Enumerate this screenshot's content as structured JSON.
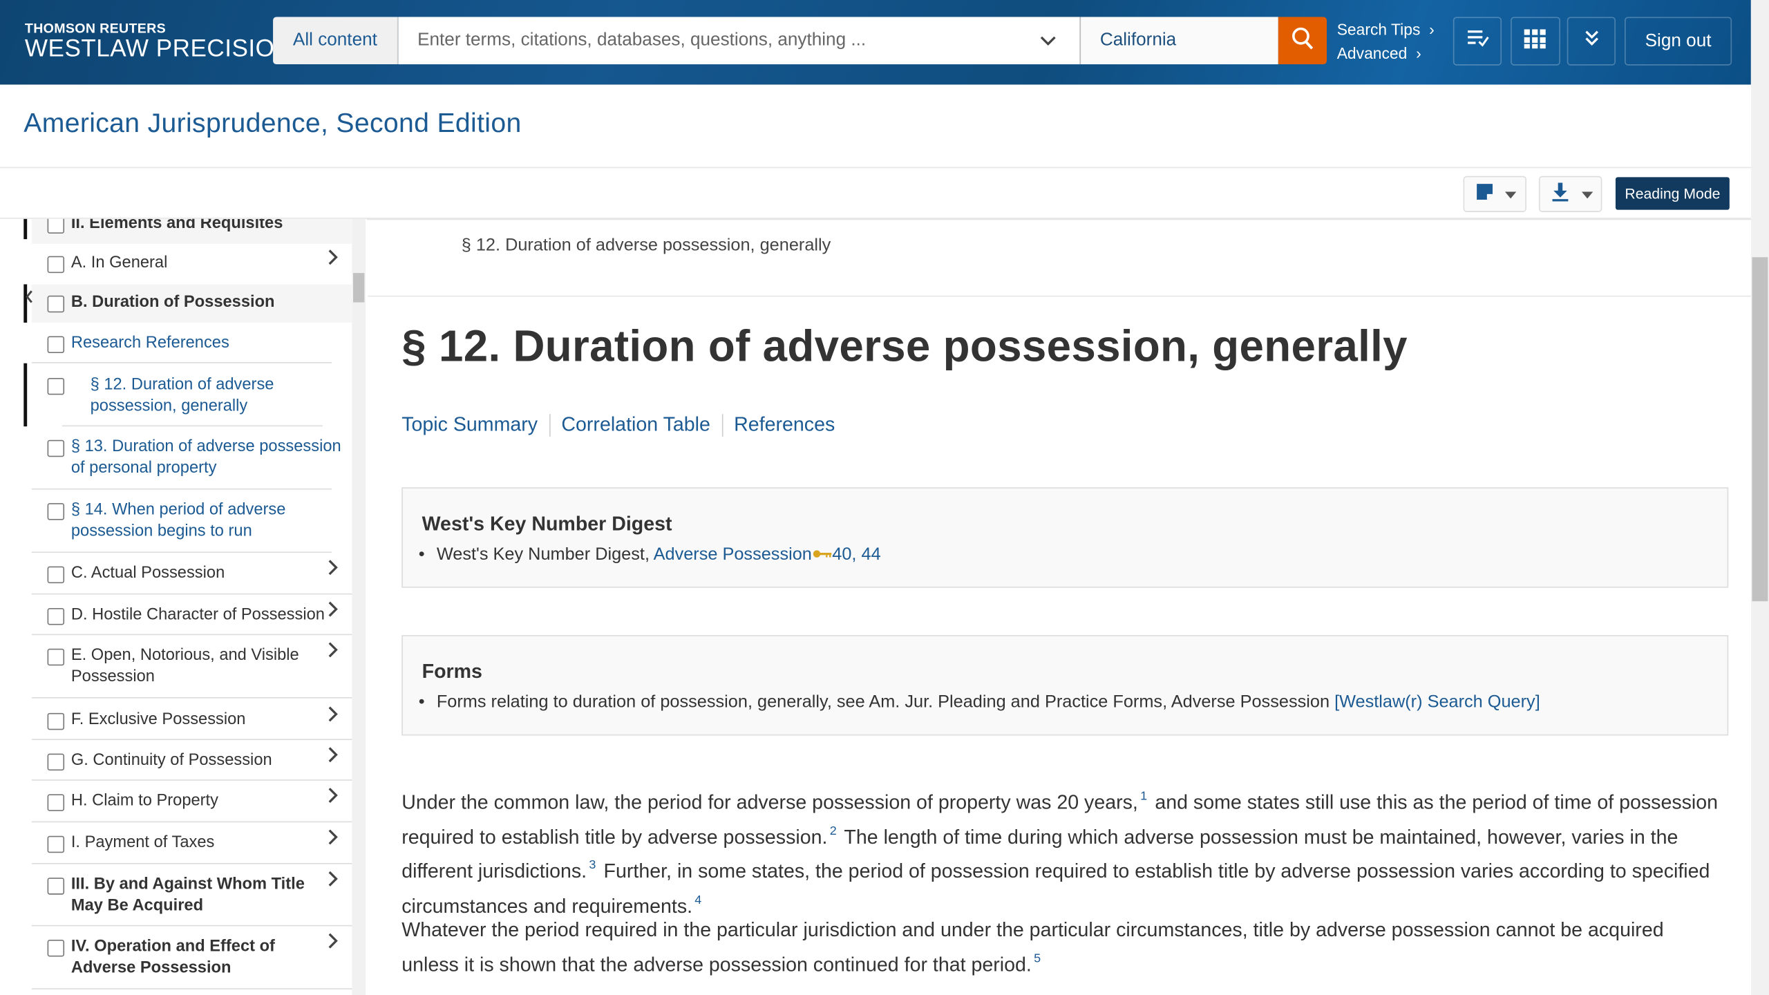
{
  "header": {
    "brand_top": "THOMSON REUTERS",
    "brand_main": "WESTLAW PRECISION",
    "scope_label": "All content",
    "search_placeholder": "Enter terms, citations, databases, questions, anything ...",
    "search_value": "",
    "jurisdiction": "California",
    "search_tips": "Search Tips",
    "advanced": "Advanced",
    "sign_out": "Sign out",
    "icons": [
      "search-icon",
      "history-icon",
      "apps-grid-icon",
      "more-chevrons-icon"
    ]
  },
  "document": {
    "title": "American Jurisprudence, Second Edition",
    "toolbar": {
      "annotate_icon": "note-icon",
      "download_icon": "download-icon",
      "reading_mode": "Reading Mode"
    },
    "breadcrumb": "§ 12. Duration of adverse possession, generally",
    "heading": "§ 12. Duration of adverse possession, generally",
    "tabs": [
      "Topic Summary",
      "Correlation Table",
      "References"
    ],
    "key_number": {
      "heading": "West's Key Number Digest",
      "item_prefix": "West's Key Number Digest, ",
      "link": "Adverse Possession",
      "numbers": "40, 44"
    },
    "forms": {
      "heading": "Forms",
      "item_text": "Forms relating to duration of possession, generally, see Am. Jur. Pleading and Practice Forms, Adverse Possession ",
      "link": "[Westlaw(r) Search Query]"
    },
    "paragraphs": [
      {
        "segments": [
          "Under the common law, the period for adverse possession of property was 20 years,",
          "1",
          " and some states still use this as the period of time of possession required to establish title by adverse possession.",
          "2",
          " The length of time during which adverse possession must be maintained, however, varies in the different jurisdictions.",
          "3",
          " Further, in some states, the period of possession required to establish title by adverse possession varies according to specified circumstances and requirements.",
          "4"
        ]
      },
      {
        "segments": [
          "Whatever the period required in the particular jurisdiction and under the particular circumstances, title by adverse possession cannot be acquired unless it is shown that the adverse possession continued for that period.",
          "5"
        ]
      }
    ]
  },
  "toc": [
    {
      "label": "II. Elements and Requisites",
      "bold": true,
      "link": false,
      "expand": false,
      "checked": false
    },
    {
      "label": "A. In General",
      "bold": false,
      "link": false,
      "expand": true,
      "checked": false
    },
    {
      "label": "B. Duration of Possession",
      "bold": true,
      "link": false,
      "expand": false,
      "checked": false
    },
    {
      "label": "Research References",
      "bold": false,
      "link": true,
      "expand": false,
      "checked": false
    },
    {
      "label": "§ 12. Duration of adverse possession, generally",
      "bold": false,
      "link": true,
      "expand": false,
      "checked": false,
      "current": true
    },
    {
      "label": "§ 13. Duration of adverse possession of personal property",
      "bold": false,
      "link": true,
      "expand": false,
      "checked": false
    },
    {
      "label": "§ 14. When period of adverse possession begins to run",
      "bold": false,
      "link": true,
      "expand": false,
      "checked": false
    },
    {
      "label": "C. Actual Possession",
      "bold": false,
      "link": false,
      "expand": true,
      "checked": false
    },
    {
      "label": "D. Hostile Character of Possession",
      "bold": false,
      "link": false,
      "expand": true,
      "checked": false
    },
    {
      "label": "E. Open, Notorious, and Visible Possession",
      "bold": false,
      "link": false,
      "expand": true,
      "checked": false
    },
    {
      "label": "F. Exclusive Possession",
      "bold": false,
      "link": false,
      "expand": true,
      "checked": false
    },
    {
      "label": "G. Continuity of Possession",
      "bold": false,
      "link": false,
      "expand": true,
      "checked": false
    },
    {
      "label": "H. Claim to Property",
      "bold": false,
      "link": false,
      "expand": true,
      "checked": false
    },
    {
      "label": "I. Payment of Taxes",
      "bold": false,
      "link": false,
      "expand": true,
      "checked": false
    },
    {
      "label": "III. By and Against Whom Title May Be Acquired",
      "bold": true,
      "link": false,
      "expand": true,
      "checked": false
    },
    {
      "label": "IV. Operation and Effect of Adverse Possession",
      "bold": true,
      "link": false,
      "expand": true,
      "checked": false
    }
  ],
  "colors": {
    "brand_blue": "#1c5a93",
    "header_bg": "#15578f",
    "search_button": "#e25d00",
    "reading_mode_bg": "#123a5e"
  }
}
